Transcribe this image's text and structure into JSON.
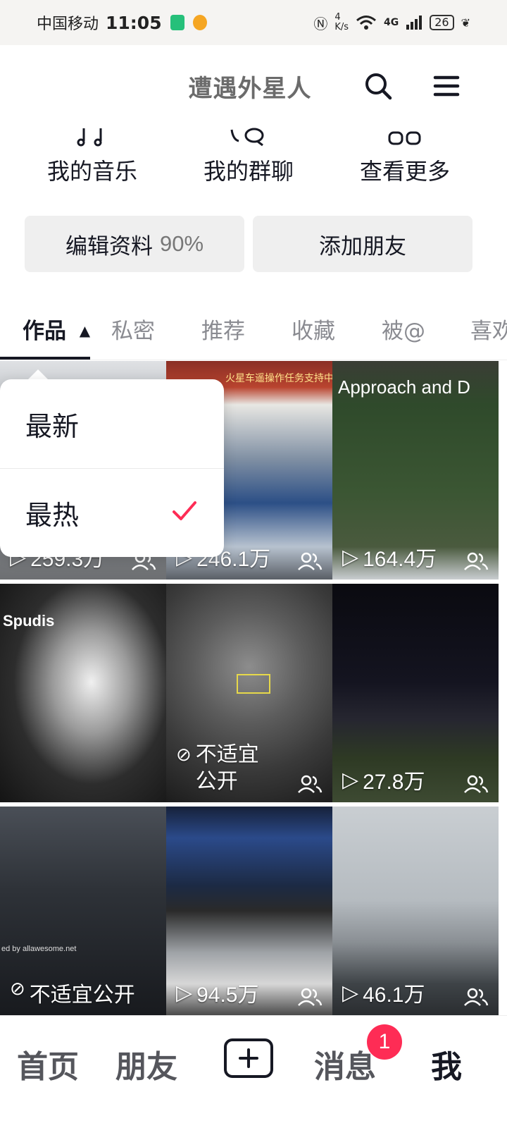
{
  "status_bar": {
    "carrier": "中国移动",
    "time": "11:05",
    "speed_top": "4",
    "speed_unit": "K/s",
    "network": "4G",
    "battery": "26"
  },
  "header": {
    "title": "遭遇外星人",
    "search_icon": "search-icon",
    "menu_icon": "hamburger-menu-icon"
  },
  "quick": [
    {
      "label": "我的音乐",
      "icon": "music-note-icon"
    },
    {
      "label": "我的群聊",
      "icon": "group-chat-icon"
    },
    {
      "label": "查看更多",
      "icon": "more-icon"
    }
  ],
  "buttons": {
    "edit_label": "编辑资料",
    "edit_percent": "90%",
    "add_friend_label": "添加朋友"
  },
  "tabs": [
    "作品",
    "私密",
    "推荐",
    "收藏",
    "被@",
    "喜欢"
  ],
  "active_tab": 0,
  "sort_menu": {
    "options": [
      "最新",
      "最热"
    ],
    "selected": 1
  },
  "videos": [
    {
      "views": "259.3万",
      "unsuitable": false
    },
    {
      "views": "246.1万",
      "unsuitable": false,
      "caption": "火星车遥操作任务支持中心"
    },
    {
      "views": "164.4万",
      "unsuitable": false,
      "caption": "Approach and D"
    },
    {
      "views": "",
      "unsuitable": false,
      "caption": "Spudis"
    },
    {
      "views": "",
      "unsuitable": true,
      "unsuitable_text": "不适宜公开"
    },
    {
      "views": "27.8万",
      "unsuitable": false
    },
    {
      "views": "",
      "unsuitable": true,
      "unsuitable_text": "不适宜公开",
      "caption": "ed by allawesome.net"
    },
    {
      "views": "94.5万",
      "unsuitable": false
    },
    {
      "views": "46.1万",
      "unsuitable": false
    }
  ],
  "bottom_nav": {
    "home": "首页",
    "friends": "朋友",
    "messages": "消息",
    "me": "我",
    "badge": "1"
  },
  "colors": {
    "accent": "#fe2c55",
    "text": "#161823"
  }
}
